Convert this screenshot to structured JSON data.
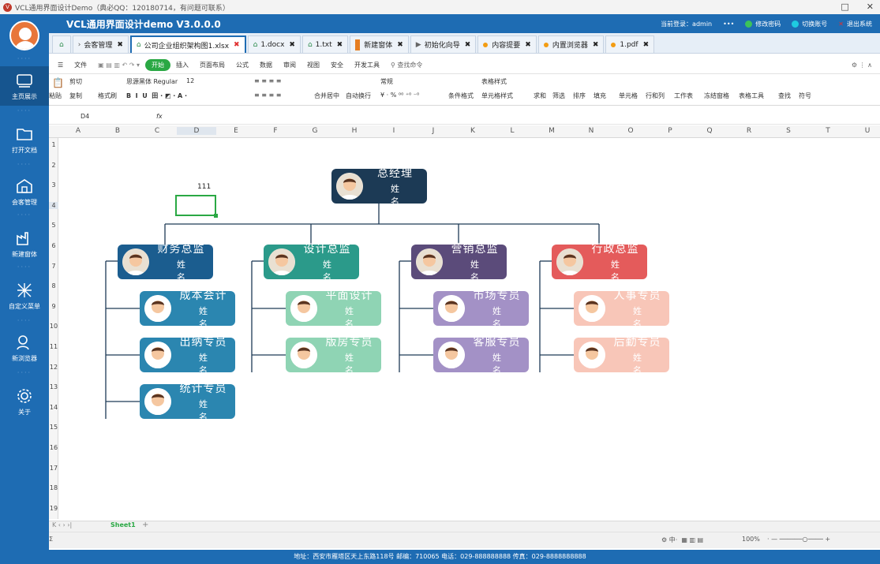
{
  "window": {
    "title": "VCL通用界面设计Demo（典必QQ：120180714，有问题可联系）"
  },
  "header": {
    "app_title": "VCL通用界面设计demo V3.0.0.0",
    "login_label": "当前登录：admin",
    "more": "•••",
    "change_pwd": "修改密码",
    "switch_account": "切换账号",
    "exit": "退出系统"
  },
  "sidebar": {
    "items": [
      {
        "label": "主页展示",
        "icon": "home-icon",
        "active": true
      },
      {
        "label": "打开文档",
        "icon": "folder-icon"
      },
      {
        "label": "会客管理",
        "icon": "building-icon"
      },
      {
        "label": "新建窗体",
        "icon": "factory-icon"
      },
      {
        "label": "自定义菜单",
        "icon": "menu-icon"
      },
      {
        "label": "新浏览器",
        "icon": "browser-icon"
      },
      {
        "label": "关于",
        "icon": "gear-icon"
      }
    ]
  },
  "tabs": [
    {
      "label": "会客管理",
      "type": "arrow"
    },
    {
      "label": "公司企业组织架构图1.xlsx",
      "type": "home",
      "active": true
    },
    {
      "label": "1.docx",
      "type": "home"
    },
    {
      "label": "1.txt",
      "type": "home"
    },
    {
      "label": "新建窗体",
      "type": "bar"
    },
    {
      "label": "初始化向导",
      "type": "play"
    },
    {
      "label": "内容提要",
      "type": "dot"
    },
    {
      "label": "内置浏览器",
      "type": "dot"
    },
    {
      "label": "1.pdf",
      "type": "dot"
    }
  ],
  "ribbon": {
    "menu_tabs": [
      "文件",
      "开始",
      "插入",
      "页面布局",
      "公式",
      "数据",
      "审阅",
      "视图",
      "安全",
      "开发工具"
    ],
    "active_tab": "开始",
    "search": "查找命令",
    "clipboard": [
      "粘贴",
      "剪切",
      "复制",
      "格式刷"
    ],
    "font_name": "思源黑体 Regular",
    "font_size": "12",
    "number_format": "常规",
    "labels": [
      "合并居中",
      "自动换行",
      "条件格式",
      "表格样式",
      "单元格样式",
      "求和",
      "筛选",
      "排序",
      "填充",
      "单元格",
      "行和列",
      "工作表",
      "冻结窗格",
      "表格工具",
      "查找",
      "符号"
    ]
  },
  "formula": {
    "cell_ref": "D4",
    "fx": "fx"
  },
  "columns": [
    "A",
    "B",
    "C",
    "D",
    "E",
    "F",
    "G",
    "H",
    "I",
    "J",
    "K",
    "L",
    "M",
    "N",
    "O",
    "P",
    "Q",
    "R",
    "S",
    "T",
    "U"
  ],
  "rows": [
    "1",
    "2",
    "3",
    "4",
    "5",
    "6",
    "7",
    "8",
    "9",
    "10",
    "11",
    "12",
    "13",
    "14",
    "15",
    "16",
    "17",
    "18",
    "19"
  ],
  "cell_text": "111",
  "org": {
    "ceo": {
      "title": "总经理",
      "name": "姓名"
    },
    "departments": [
      {
        "title": "财务总监",
        "name": "姓名",
        "color": "#1b5d8f",
        "children": [
          {
            "title": "成本会计",
            "name": "姓名"
          },
          {
            "title": "出纳专员",
            "name": "姓名"
          },
          {
            "title": "统计专员",
            "name": "姓名"
          }
        ],
        "child_color": "#2b86b0"
      },
      {
        "title": "设计总监",
        "name": "姓名",
        "color": "#2b9a8a",
        "children": [
          {
            "title": "平面设计",
            "name": "姓名"
          },
          {
            "title": "版房专员",
            "name": "姓名"
          }
        ],
        "child_color": "#8fd4b4"
      },
      {
        "title": "营销总监",
        "name": "姓名",
        "color": "#5b4b7a",
        "children": [
          {
            "title": "市场专员",
            "name": "姓名"
          },
          {
            "title": "客服专员",
            "name": "姓名"
          }
        ],
        "child_color": "#a391c6"
      },
      {
        "title": "行政总监",
        "name": "姓名",
        "color": "#e45b5b",
        "children": [
          {
            "title": "人事专员",
            "name": "姓名"
          },
          {
            "title": "后勤专员",
            "name": "姓名"
          }
        ],
        "child_color": "#f8c6b8"
      }
    ]
  },
  "sheet": {
    "name": "Sheet1",
    "add": "+"
  },
  "status": {
    "zoom": "100%"
  },
  "footer": {
    "text": "地址：西安市雁塔区天上东路118号  邮编：710065  电话：029-888888888  传真：029-8888888888"
  }
}
